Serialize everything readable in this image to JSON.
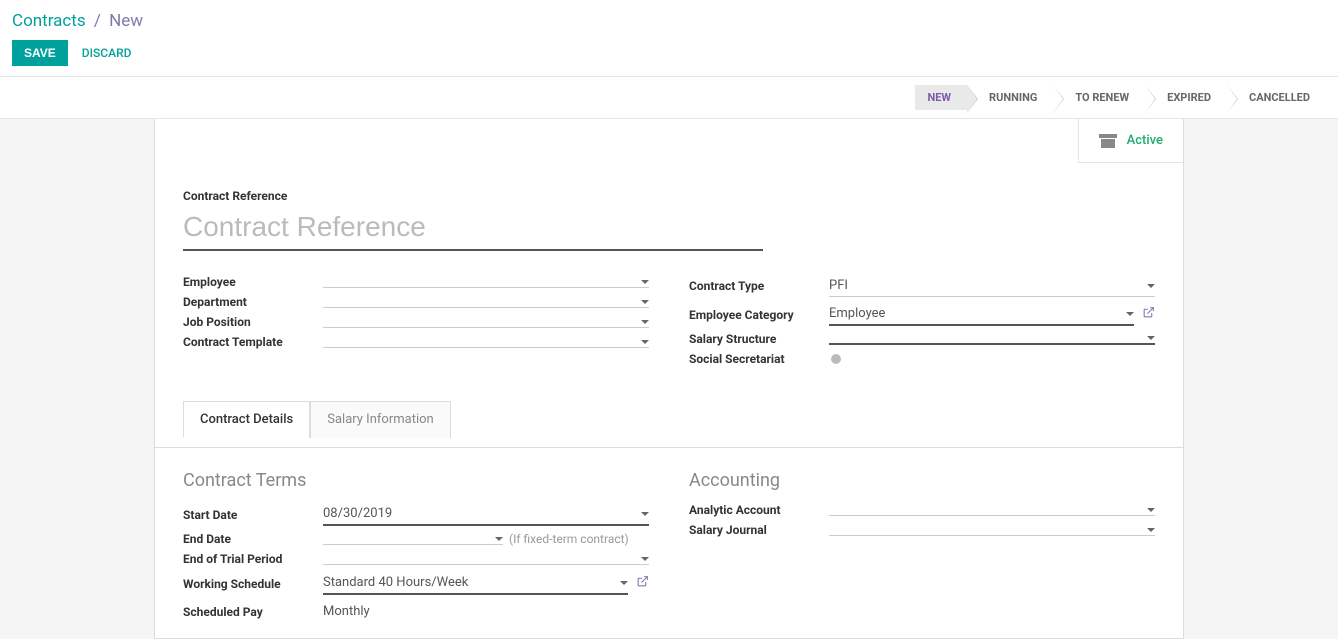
{
  "breadcrumb": {
    "parent": "Contracts",
    "sep": "/",
    "current": "New"
  },
  "actions": {
    "save": "SAVE",
    "discard": "DISCARD"
  },
  "status": {
    "steps": [
      "NEW",
      "RUNNING",
      "TO RENEW",
      "EXPIRED",
      "CANCELLED"
    ],
    "active_index": 0
  },
  "active_button": {
    "label": "Active"
  },
  "reference": {
    "label": "Contract Reference",
    "placeholder": "Contract Reference",
    "value": ""
  },
  "fields_left": {
    "employee": {
      "label": "Employee",
      "value": ""
    },
    "department": {
      "label": "Department",
      "value": ""
    },
    "job_position": {
      "label": "Job Position",
      "value": ""
    },
    "contract_template": {
      "label": "Contract Template",
      "value": ""
    }
  },
  "fields_right": {
    "contract_type": {
      "label": "Contract Type",
      "value": "PFI"
    },
    "employee_category": {
      "label": "Employee Category",
      "value": "Employee"
    },
    "salary_structure": {
      "label": "Salary Structure",
      "value": ""
    },
    "social_secretariat": {
      "label": "Social Secretariat"
    }
  },
  "tabs": {
    "details": "Contract Details",
    "salary": "Salary Information"
  },
  "contract_terms": {
    "title": "Contract Terms",
    "start_date": {
      "label": "Start Date",
      "value": "08/30/2019"
    },
    "end_date": {
      "label": "End Date",
      "value": "",
      "hint": "(If fixed-term contract)"
    },
    "end_trial": {
      "label": "End of Trial Period",
      "value": ""
    },
    "working_schedule": {
      "label": "Working Schedule",
      "value": "Standard 40 Hours/Week"
    },
    "scheduled_pay": {
      "label": "Scheduled Pay",
      "value": "Monthly"
    }
  },
  "accounting": {
    "title": "Accounting",
    "analytic_account": {
      "label": "Analytic Account",
      "value": ""
    },
    "salary_journal": {
      "label": "Salary Journal",
      "value": ""
    }
  }
}
